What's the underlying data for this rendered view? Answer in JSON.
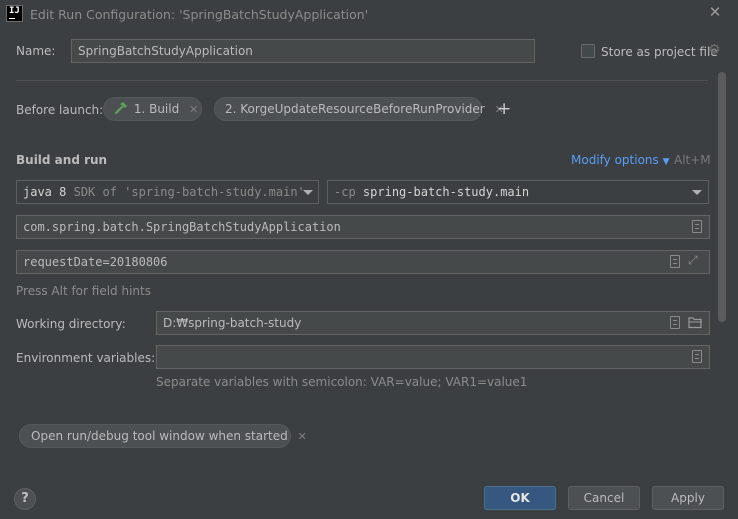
{
  "window": {
    "title": "Edit Run Configuration: 'SpringBatchStudyApplication'",
    "app_icon_text": "IJ"
  },
  "name_row": {
    "label": "Name:",
    "value": "SpringBatchStudyApplication",
    "store_label": "Store as project file",
    "store_checked": false
  },
  "before_launch": {
    "label": "Before launch:",
    "tasks": [
      {
        "label": "1. Build",
        "icon": "hammer-icon"
      },
      {
        "label": "2. KorgeUpdateResourceBeforeRunProvider"
      }
    ],
    "add_label": "+"
  },
  "build_and_run": {
    "title": "Build and run",
    "modify_options": "Modify options",
    "modify_shortcut": "Alt+M",
    "jre": {
      "prefix": "java 8",
      "suffix": "SDK of 'spring-batch-study.main'"
    },
    "classpath": {
      "prefix": "-cp",
      "module": "spring-batch-study.main"
    },
    "main_class": "com.spring.batch.SpringBatchStudyApplication",
    "program_args": "requestDate=20180806",
    "field_hint": "Press Alt for field hints"
  },
  "working_directory": {
    "label": "Working directory:",
    "value": "D:₩spring-batch-study"
  },
  "environment": {
    "label": "Environment variables:",
    "value": "",
    "hint": "Separate variables with semicolon: VAR=value; VAR1=value1"
  },
  "options": {
    "open_tool_window": "Open run/debug tool window when started"
  },
  "footer": {
    "help": "?",
    "ok": "OK",
    "cancel": "Cancel",
    "apply": "Apply"
  }
}
